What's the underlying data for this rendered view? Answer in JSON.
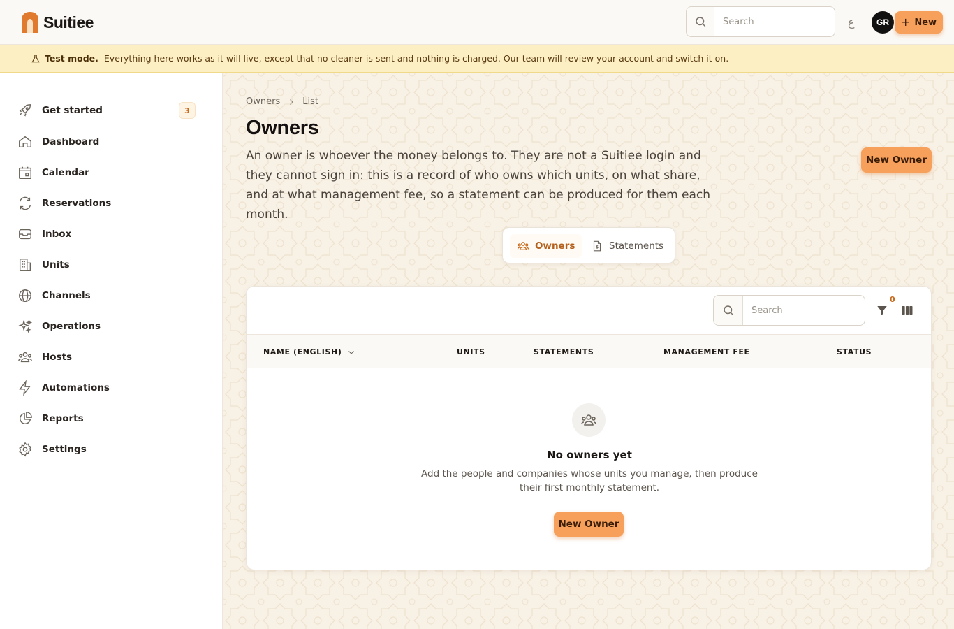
{
  "app": {
    "brand": "Suitiee",
    "search_placeholder": "Search",
    "lang_toggle": "ع",
    "avatar_initials": "GR",
    "new_label": "New",
    "accent": "#f6a05b"
  },
  "banner": {
    "title": "Test mode.",
    "text": "Everything here works as it will live, except that no cleaner is sent and nothing is charged. Our team will review your account and switch it on."
  },
  "sidebar": {
    "items": [
      {
        "label": "Get started",
        "icon": "rocket-icon",
        "badge": "3"
      },
      {
        "label": "Dashboard",
        "icon": "home-icon"
      },
      {
        "label": "Calendar",
        "icon": "calendar-icon"
      },
      {
        "label": "Reservations",
        "icon": "refresh-icon"
      },
      {
        "label": "Inbox",
        "icon": "inbox-icon"
      },
      {
        "label": "Units",
        "icon": "building-icon"
      },
      {
        "label": "Channels",
        "icon": "globe-icon"
      },
      {
        "label": "Operations",
        "icon": "sparkle-icon"
      },
      {
        "label": "Hosts",
        "icon": "users-icon"
      },
      {
        "label": "Automations",
        "icon": "bolt-icon"
      },
      {
        "label": "Reports",
        "icon": "pie-chart-icon"
      },
      {
        "label": "Settings",
        "icon": "gear-icon"
      }
    ]
  },
  "page": {
    "breadcrumb": [
      "Owners",
      "List"
    ],
    "title": "Owners",
    "description": "An owner is whoever the money belongs to. They are not a Suitiee login and they cannot sign in: this is a record of who owns which units, on what share, and at what management fee, so a statement can be produced for them each month.",
    "new_owner_label": "New Owner"
  },
  "tabs": [
    {
      "label": "Owners",
      "icon": "users-icon",
      "active": true
    },
    {
      "label": "Statements",
      "icon": "dollar-file-icon",
      "active": false
    }
  ],
  "table": {
    "search_placeholder": "Search",
    "filter_count": "0",
    "columns": [
      "NAME (ENGLISH)",
      "UNITS",
      "STATEMENTS",
      "MANAGEMENT FEE",
      "STATUS"
    ],
    "rows": []
  },
  "empty": {
    "title": "No owners yet",
    "description": "Add the people and companies whose units you manage, then produce their first monthly statement.",
    "button_label": "New Owner"
  }
}
